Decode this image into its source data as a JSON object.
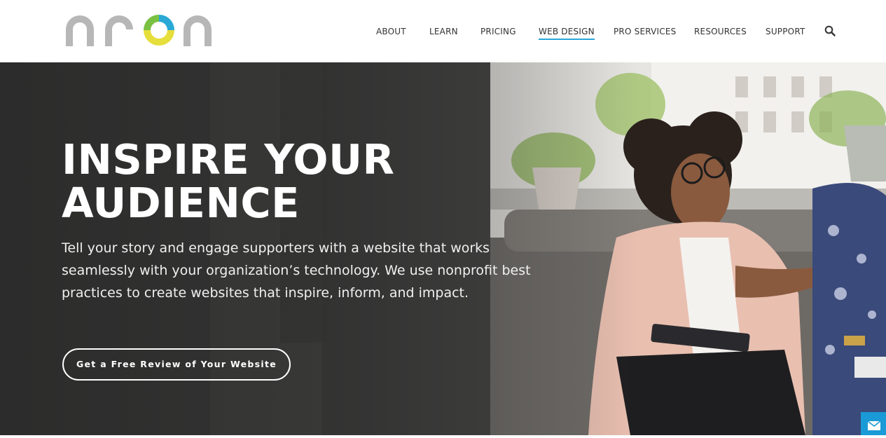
{
  "brand": {
    "logo_text": "neon",
    "logo_colors": [
      "#b8b8b8",
      "#2aa8d6",
      "#e8e040",
      "#7ac143"
    ]
  },
  "nav": {
    "items": [
      {
        "label": "ABOUT"
      },
      {
        "label": "LEARN"
      },
      {
        "label": "PRICING"
      },
      {
        "label": "WEB DESIGN",
        "active": true
      },
      {
        "label": "PRO SERVICES"
      },
      {
        "label": "RESOURCES"
      },
      {
        "label": "SUPPORT"
      }
    ],
    "search_icon": "search-icon",
    "active_color": "#2aa8d6"
  },
  "hero": {
    "title_line1": "INSPIRE YOUR",
    "title_line2": "AUDIENCE",
    "text": "Tell your story and engage supporters with a website that works seamlessly with your organization’s technology. We use nonprofit best practices to create websites that inspire, inform, and impact.",
    "cta_label": "Get a Free Review of Your Website"
  },
  "chat_widget": {
    "icon": "envelope-icon",
    "color": "#1a9ad6"
  }
}
